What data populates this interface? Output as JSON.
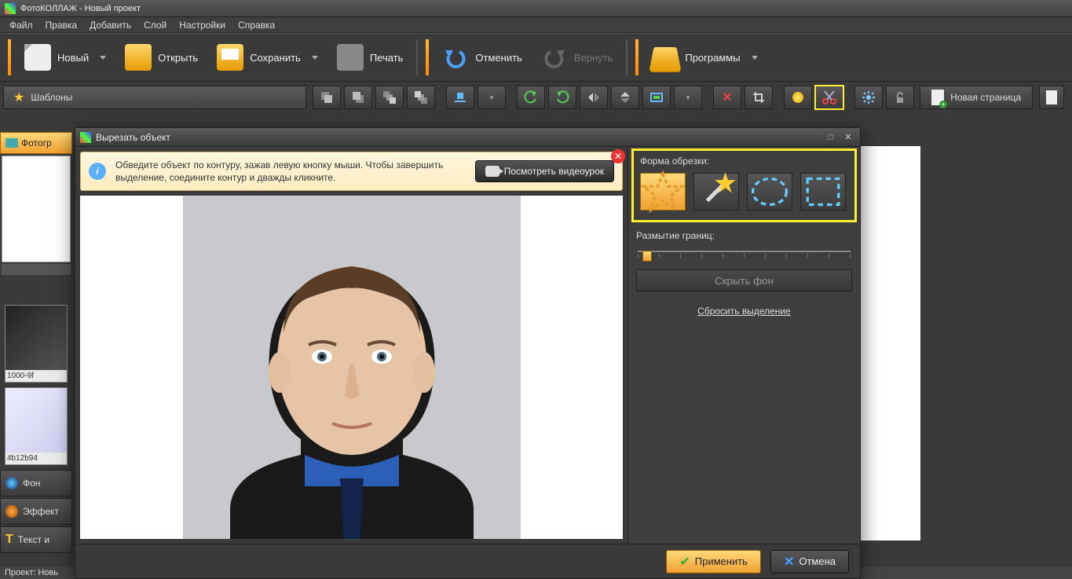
{
  "app": {
    "title": "ФотоКОЛЛАЖ - Новый проект"
  },
  "menu": {
    "file": "Файл",
    "edit": "Правка",
    "add": "Добавить",
    "layer": "Слой",
    "settings": "Настройки",
    "help": "Справка"
  },
  "toolbar": {
    "new": "Новый",
    "open": "Открыть",
    "save": "Сохранить",
    "print": "Печать",
    "undo": "Отменить",
    "redo": "Вернуть",
    "programs": "Программы"
  },
  "sectoolbar": {
    "templates": "Шаблоны",
    "newpage": "Новая страница"
  },
  "leftpanel": {
    "tab": "Фотогр",
    "thumbs": [
      {
        "cap": "1000-9f"
      },
      {
        "cap": "4b12b94"
      }
    ],
    "sect_bg": "Фон",
    "sect_fx": "Эффект",
    "sect_text": "Текст и"
  },
  "status": {
    "project": "Проект:  Новь"
  },
  "dialog": {
    "title": "Вырезать объект",
    "info_text": "Обведите объект по контуру, зажав левую кнопку мыши. Чтобы завершить выделение, соедините контур и дважды кликните.",
    "video_btn": "Посмотреть видеоурок",
    "crop_shape_label": "Форма обрезки:",
    "blur_label": "Размытие границ:",
    "hide_bg": "Скрыть фон",
    "reset": "Сбросить выделение",
    "apply": "Применить",
    "cancel": "Отмена"
  }
}
